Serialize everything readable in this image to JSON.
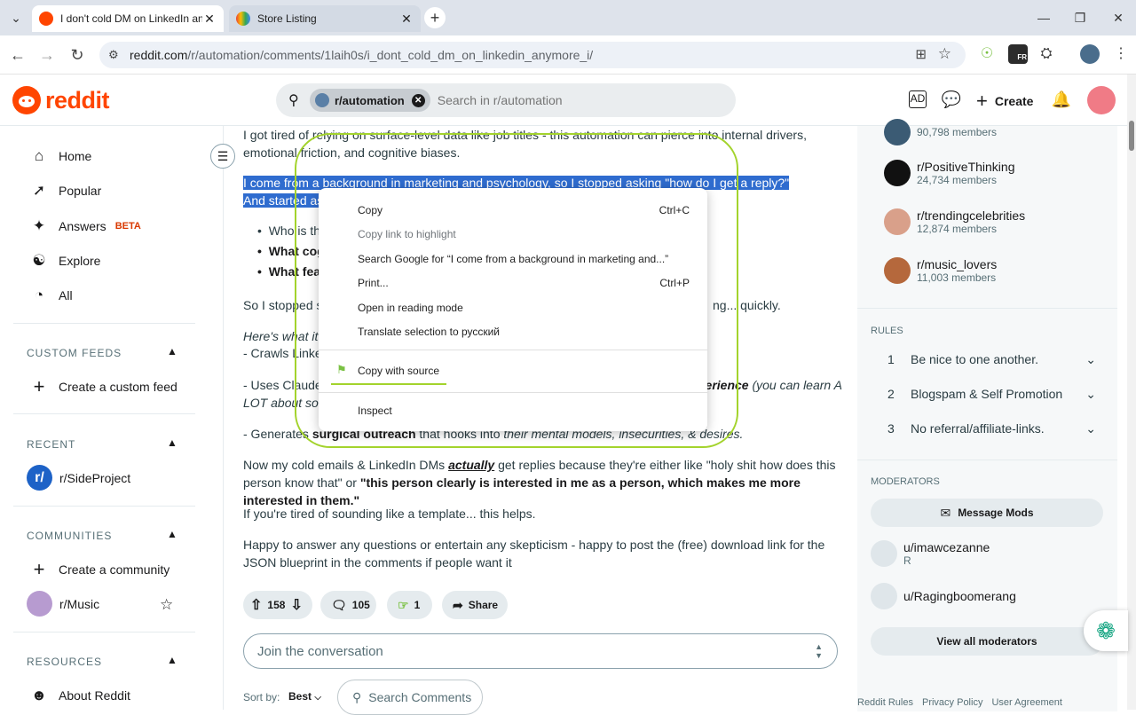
{
  "browser": {
    "tabs": [
      {
        "title": "I don't cold DM on LinkedIn an",
        "active": true
      },
      {
        "title": "Store Listing",
        "active": false
      }
    ],
    "url_host": "reddit.com",
    "url_path": "/r/automation/comments/1laih0s/i_dont_cold_dm_on_linkedin_anymore_i/",
    "ext_badge": "FR"
  },
  "header": {
    "logo": "reddit",
    "search_chip": "r/automation",
    "search_placeholder": "Search in r/automation",
    "create_label": "Create"
  },
  "sidebar": {
    "nav": [
      {
        "label": "Home",
        "icon": "home-icon"
      },
      {
        "label": "Popular",
        "icon": "popular-icon"
      },
      {
        "label": "Answers",
        "icon": "answers-icon",
        "badge": "BETA"
      },
      {
        "label": "Explore",
        "icon": "explore-icon"
      },
      {
        "label": "All",
        "icon": "all-icon"
      }
    ],
    "custom_feeds_title": "CUSTOM FEEDS",
    "create_custom_feed": "Create a custom feed",
    "recent_title": "RECENT",
    "recent_item": "r/SideProject",
    "communities_title": "COMMUNITIES",
    "create_community": "Create a community",
    "community_item": "r/Music",
    "resources_title": "RESOURCES",
    "about": "About Reddit"
  },
  "post": {
    "p1": "I got tired of relying on surface-level data like job titles - this automation can pierce into internal drivers, emotional friction, and cognitive biases.",
    "p2_line1": "I come from a background in marketing and psychology, so I stopped asking \"how do I get a reply?\"",
    "p2_line2": "And started ask",
    "bullet1": "Who is th",
    "bullet2": "What cog",
    "bullet3": "What fea",
    "p3_start": "So I stopped st",
    "p3_end": "ng... quickly.",
    "p4_italic": "Here's what it a",
    "p4_crawl": "- Crawls Linked",
    "p5_start": "- Uses Claude 3",
    "p5_bold": "perience",
    "p5_rest": " (you can learn A",
    "p5_line2": "LOT about som",
    "p6_start": "- Generates ",
    "p6_bold": "surgical outreach",
    "p6_mid": " that hooks into ",
    "p6_italic": "their mental models, insecurities, & desires.",
    "p7_start": "Now my cold emails & LinkedIn DMs ",
    "p7_em": "actually",
    "p7_rest": " get replies because they're either like \"holy shit how does this person know that\" or ",
    "p7_bold": "\"this person clearly is interested in me as a person, which makes me more interested in them.\"",
    "p8": "If you're tired of sounding like a template... this helps.",
    "p9": "Happy to answer any questions or entertain any skepticism - happy to post the (free) download link for the JSON blueprint in the comments if people want it",
    "votes": "158",
    "comments": "105",
    "awards": "1",
    "share": "Share",
    "join_placeholder": "Join the conversation",
    "sort_label": "Sort by:",
    "sort_value": "Best",
    "search_comments": "Search Comments"
  },
  "context_menu": {
    "items": [
      {
        "label": "Copy",
        "shortcut": "Ctrl+C",
        "disabled": false
      },
      {
        "label": "Copy link to highlight",
        "shortcut": "",
        "disabled": true
      },
      {
        "label": "Search Google for “I come from a background in marketing and...”",
        "shortcut": "",
        "disabled": false
      },
      {
        "label": "Print...",
        "shortcut": "Ctrl+P",
        "disabled": false
      },
      {
        "label": "Open in reading mode",
        "shortcut": "",
        "disabled": false
      },
      {
        "label": "Translate selection to русский",
        "shortcut": "",
        "disabled": false
      },
      {
        "label": "Copy with source",
        "shortcut": "",
        "disabled": false
      },
      {
        "label": "Inspect",
        "shortcut": "",
        "disabled": false
      }
    ]
  },
  "right_sidebar": {
    "communities": [
      {
        "name": "",
        "members": "90,798 members",
        "color": "#3b5b74"
      },
      {
        "name": "r/PositiveThinking",
        "members": "24,734 members",
        "color": "#111111"
      },
      {
        "name": "r/trendingcelebrities",
        "members": "12,874 members",
        "color": "#d9a08a"
      },
      {
        "name": "r/music_lovers",
        "members": "11,003 members",
        "color": "#b5683c"
      }
    ],
    "rules_title": "RULES",
    "rules": [
      {
        "n": "1",
        "text": "Be nice to one another."
      },
      {
        "n": "2",
        "text": "Blogspam & Self Promotion"
      },
      {
        "n": "3",
        "text": "No referral/affiliate-links."
      }
    ],
    "moderators_title": "MODERATORS",
    "message_mods": "Message Mods",
    "mods": [
      {
        "name": "u/imawcezanne",
        "flair": "R"
      },
      {
        "name": "u/Ragingboomerang",
        "flair": ""
      }
    ],
    "view_all": "View all moderators",
    "footer": [
      "Reddit Rules",
      "Privacy Policy",
      "User Agreement"
    ]
  }
}
